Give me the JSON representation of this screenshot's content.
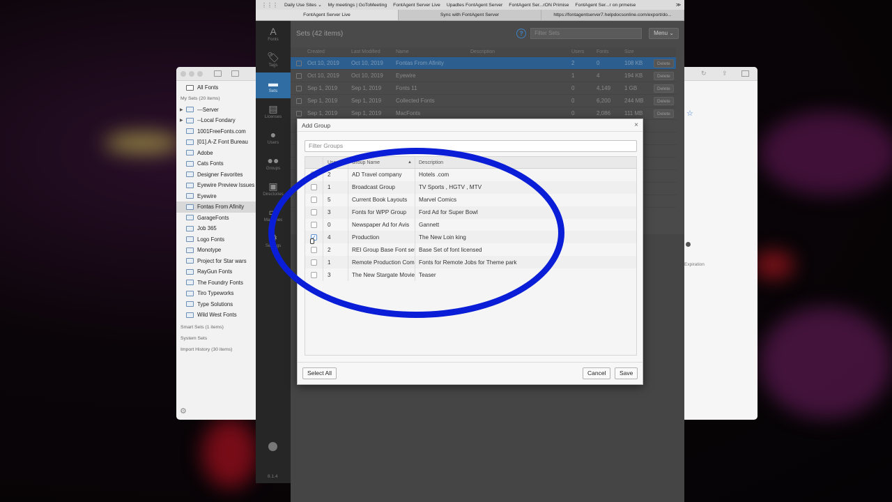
{
  "colors": {
    "accent": "#2f6da3",
    "circle": "#0a1ed8"
  },
  "bookmarks": [
    "Daily Use Sites ⌄",
    "My meetings | GoToMeeting",
    "FontAgent Server Live",
    "Upadtes FontAgent Server",
    "FontAgent Ser...rON Primise",
    "FontAgent Ser...r on prmeise"
  ],
  "tabs": [
    "FontAgent Server Live",
    "Sync with FontAgent Server",
    "https://fontagentserver7.helpdocsonline.com/export/do..."
  ],
  "rail": [
    {
      "icon": "A",
      "label": "Fonts"
    },
    {
      "icon": "🏷",
      "label": "Tags"
    },
    {
      "icon": "▬",
      "label": "Sets"
    },
    {
      "icon": "▤",
      "label": "Licenses"
    },
    {
      "icon": "●",
      "label": "Users"
    },
    {
      "icon": "●●",
      "label": "Groups"
    },
    {
      "icon": "▣",
      "label": "Directories"
    },
    {
      "icon": "▭",
      "label": "Machines"
    },
    {
      "icon": "⚙",
      "label": "Settings"
    }
  ],
  "version": "8.1.4",
  "sets": {
    "title": "Sets (42 items)",
    "filter_placeholder": "Filter Sets",
    "menu_label": "Menu ⌄",
    "headers": [
      "Created",
      "Last Modified",
      "Name",
      "Description",
      "Users",
      "Fonts",
      "Size"
    ],
    "rows": [
      {
        "created": "Oct 10, 2019",
        "modified": "Oct 10, 2019",
        "name": "Fontas From Afinity",
        "desc": "",
        "users": "2",
        "fonts": "0",
        "size": "108 KB",
        "action": "Delete"
      },
      {
        "created": "Oct 10, 2019",
        "modified": "Oct 10, 2019",
        "name": "Eyewire",
        "desc": "",
        "users": "1",
        "fonts": "4",
        "size": "194 KB",
        "action": "Delete"
      },
      {
        "created": "Sep 1, 2019",
        "modified": "Sep 1, 2019",
        "name": "Fonts 11",
        "desc": "",
        "users": "0",
        "fonts": "4,149",
        "size": "1 GB",
        "action": "Delete"
      },
      {
        "created": "Sep 1, 2019",
        "modified": "Sep 1, 2019",
        "name": "Collected Fonts",
        "desc": "",
        "users": "0",
        "fonts": "6,200",
        "size": "244 MB",
        "action": "Delete"
      },
      {
        "created": "Sep 1, 2019",
        "modified": "Sep 1, 2019",
        "name": "MacFonts",
        "desc": "",
        "users": "0",
        "fonts": "2,086",
        "size": "111 MB",
        "action": "Delete"
      }
    ]
  },
  "finder": {
    "all_fonts": "All Fonts",
    "my_sets_label": "My Sets (20 items)",
    "items": [
      "---Server",
      "--Local Fondary",
      "1001FreeFonts.com",
      "[01].A-Z Font Bureau",
      "Adobe",
      "Cats Fonts",
      "Designer Favorites",
      "Eyewire Preview Issues",
      "Eyewire",
      "Fontas From Afinity",
      "GarageFonts",
      "Job 365",
      "Logo Fonts",
      "Monotype",
      "Project for Star wars",
      "RayGun Fonts",
      "The Foundry Fonts",
      "Tiro Typeworks",
      "Type Solutions",
      "Wild West Fonts"
    ],
    "smart_sets": "Smart Sets (1 items)",
    "system_sets": "System Sets",
    "import_history": "Import History (30 items)"
  },
  "dialog": {
    "title": "Add Group",
    "filter_placeholder": "Filter Groups",
    "headers": {
      "users": "Use",
      "name": "Group Name",
      "desc": "Description"
    },
    "rows": [
      {
        "users": "2",
        "name": "AD Travel company",
        "desc": "Hotels .com",
        "checked": false
      },
      {
        "users": "1",
        "name": "Broadcast Group",
        "desc": "TV Sports , HGTV , MTV",
        "checked": false
      },
      {
        "users": "5",
        "name": "Current Book Layouts",
        "desc": "Marvel Comics",
        "checked": false
      },
      {
        "users": "3",
        "name": "Fonts for WPP Group",
        "desc": "Ford Ad for Super Bowl",
        "checked": false
      },
      {
        "users": "0",
        "name": "Newspaper Ad for Avis",
        "desc": "Gannett",
        "checked": false
      },
      {
        "users": "4",
        "name": "Production",
        "desc": "The New Loin king",
        "checked": true
      },
      {
        "users": "2",
        "name": "REI Group Base Font set",
        "desc": "Base Set of font licensed",
        "checked": false
      },
      {
        "users": "1",
        "name": "Remote Production Com",
        "desc": "Fonts for Remote Jobs for Theme park",
        "checked": false
      },
      {
        "users": "3",
        "name": "The New Stargate Movie",
        "desc": "Teaser",
        "checked": false
      }
    ],
    "select_all": "Select All",
    "cancel": "Cancel",
    "save": "Save"
  },
  "right_panel": {
    "expiration": "Expiration"
  }
}
